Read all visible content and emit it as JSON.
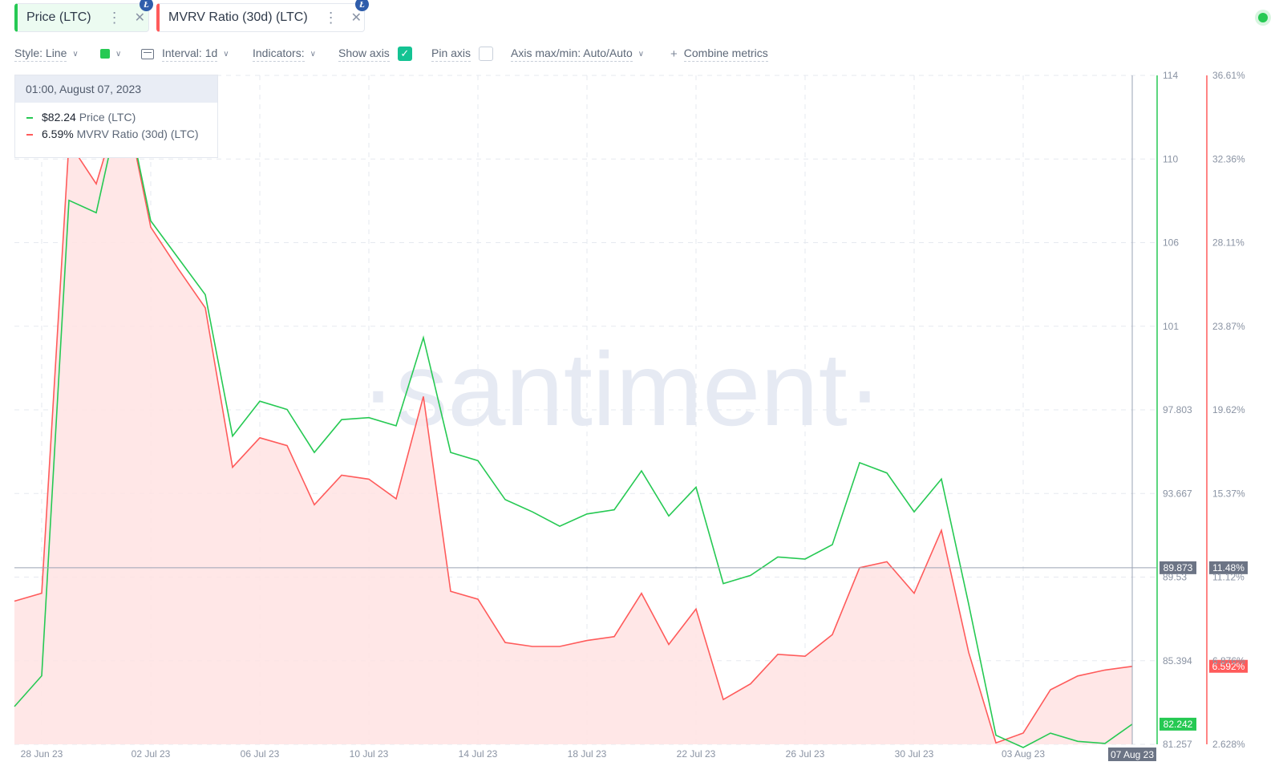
{
  "metric_chips": [
    {
      "label": "Price (LTC)",
      "menu_icon": "more-vertical-icon",
      "close_icon": "close-icon",
      "badge": "litecoin-info-icon",
      "color": "#26c953"
    },
    {
      "label": "MVRV Ratio (30d) (LTC)",
      "menu_icon": "more-vertical-icon",
      "close_icon": "close-icon",
      "badge": "litecoin-info-icon",
      "color": "#ff5b5b"
    }
  ],
  "toolbar": {
    "style_label": "Style: Line",
    "interval_label": "Interval: 1d",
    "indicators_label": "Indicators:",
    "show_axis_label": "Show axis",
    "show_axis_checked": true,
    "pin_axis_label": "Pin axis",
    "pin_axis_checked": false,
    "axis_minmax_label": "Axis max/min: Auto/Auto",
    "combine_label": "Combine metrics"
  },
  "tooltip": {
    "date": "01:00, August 07, 2023",
    "rows": [
      {
        "value": "$82.24",
        "name": "Price (LTC)",
        "color": "#26c953"
      },
      {
        "value": "6.59%",
        "name": "MVRV Ratio (30d) (LTC)",
        "color": "#ff5b5b"
      }
    ]
  },
  "watermark": "·santiment·",
  "chart_data": {
    "type": "line",
    "x": [
      "27 Jun 23",
      "28 Jun 23",
      "29 Jun 23",
      "30 Jun 23",
      "01 Jul 23",
      "02 Jul 23",
      "03 Jul 23",
      "04 Jul 23",
      "05 Jul 23",
      "06 Jul 23",
      "07 Jul 23",
      "08 Jul 23",
      "09 Jul 23",
      "10 Jul 23",
      "11 Jul 23",
      "12 Jul 23",
      "13 Jul 23",
      "14 Jul 23",
      "15 Jul 23",
      "16 Jul 23",
      "17 Jul 23",
      "18 Jul 23",
      "19 Jul 23",
      "20 Jul 23",
      "21 Jul 23",
      "22 Jul 23",
      "23 Jul 23",
      "24 Jul 23",
      "25 Jul 23",
      "26 Jul 23",
      "27 Jul 23",
      "28 Jul 23",
      "29 Jul 23",
      "30 Jul 23",
      "31 Jul 23",
      "01 Aug 23",
      "02 Aug 23",
      "03 Aug 23",
      "04 Aug 23",
      "05 Aug 23",
      "06 Aug 23",
      "07 Aug 23"
    ],
    "x_ticks": [
      "28 Jun 23",
      "02 Jul 23",
      "06 Jul 23",
      "10 Jul 23",
      "14 Jul 23",
      "18 Jul 23",
      "22 Jul 23",
      "26 Jul 23",
      "30 Jul 23",
      "03 Aug 23",
      "07 Aug 23"
    ],
    "series": [
      {
        "name": "Price (LTC)",
        "color": "#26c953",
        "axis": "left",
        "values": [
          83.1,
          84.6,
          107.8,
          107.2,
          113.2,
          106.8,
          105.0,
          103.2,
          96.3,
          98.0,
          97.6,
          95.5,
          97.1,
          97.2,
          96.8,
          101.1,
          95.5,
          95.1,
          93.2,
          92.6,
          91.9,
          92.5,
          92.7,
          94.6,
          92.4,
          93.8,
          89.1,
          89.5,
          90.4,
          90.3,
          91.0,
          95.0,
          94.5,
          92.6,
          94.2,
          88.1,
          81.7,
          81.1,
          81.8,
          81.4,
          81.3,
          82.24
        ]
      },
      {
        "name": "MVRV Ratio (30d) (LTC)",
        "color": "#ff5b5b",
        "axis": "right",
        "values": [
          9.9,
          10.3,
          33.2,
          31.1,
          35.7,
          28.9,
          26.8,
          24.8,
          16.7,
          18.2,
          17.8,
          14.8,
          16.3,
          16.1,
          15.1,
          20.3,
          10.4,
          10.0,
          7.8,
          7.6,
          7.6,
          7.9,
          8.1,
          10.3,
          7.7,
          9.5,
          4.9,
          5.7,
          7.2,
          7.1,
          8.2,
          11.6,
          11.9,
          10.3,
          13.5,
          7.3,
          2.7,
          3.2,
          5.4,
          6.1,
          6.4,
          6.59
        ]
      }
    ],
    "left_axis": {
      "ticks": [
        "114",
        "110",
        "106",
        "101",
        "97.803",
        "93.667",
        "89.53",
        "85.394",
        "81.257"
      ],
      "range": [
        81.257,
        113.9
      ]
    },
    "right_axis": {
      "ticks": [
        "36.61%",
        "32.36%",
        "28.11%",
        "23.87%",
        "19.62%",
        "15.37%",
        "11.12%",
        "6.876%",
        "2.628%"
      ],
      "range": [
        2.628,
        36.61
      ]
    },
    "crosshair": {
      "left_value": "89.873",
      "right_value": "11.48%",
      "date": "07 Aug 23"
    },
    "last_labels": {
      "price": "82.242",
      "mvrv": "6.592%"
    }
  }
}
